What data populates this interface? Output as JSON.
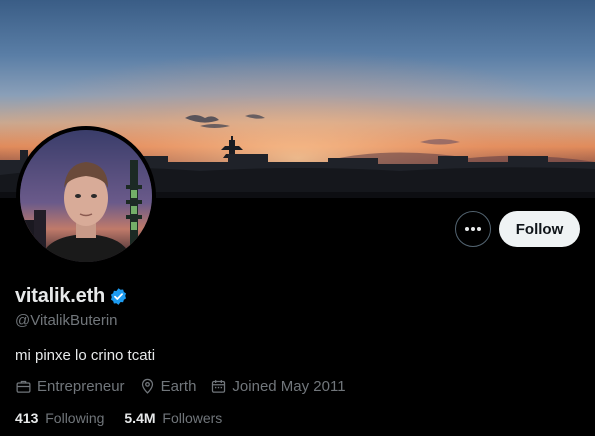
{
  "profile": {
    "display_name": "vitalik.eth",
    "handle": "@VitalikButerin",
    "bio": "mi pinxe lo crino tcati",
    "verified_icon": "verified-badge-icon",
    "accent_color": "#1d9bf0"
  },
  "actions": {
    "more_icon": "more-horizontal-icon",
    "follow_label": "Follow"
  },
  "meta": {
    "profession": "Entrepreneur",
    "profession_icon": "briefcase-icon",
    "location": "Earth",
    "location_icon": "location-pin-icon",
    "joined": "Joined May 2011",
    "joined_icon": "calendar-icon"
  },
  "stats": {
    "following_count": "413",
    "following_label": "Following",
    "followers_count": "5.4M",
    "followers_label": "Followers"
  },
  "colors": {
    "background": "#000000",
    "text_primary": "#e7e9ea",
    "text_secondary": "#71767b",
    "button_light": "#eff3f4"
  }
}
